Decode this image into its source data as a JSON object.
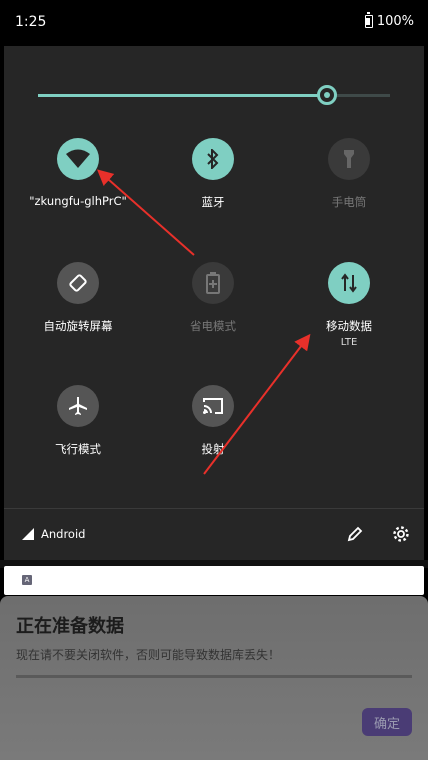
{
  "status_bar": {
    "time": "1:25",
    "battery": "100%"
  },
  "brightness": {
    "level": 0.82
  },
  "tiles": [
    {
      "label": "\"zkungfu-glhPrC\"",
      "icon": "wifi-icon",
      "state": "on"
    },
    {
      "label": "蓝牙",
      "icon": "bluetooth-icon",
      "state": "on"
    },
    {
      "label": "手电筒",
      "icon": "flashlight-icon",
      "state": "dim"
    },
    {
      "label": "自动旋转屏幕",
      "icon": "auto-rotate-icon",
      "state": "off"
    },
    {
      "label": "省电模式",
      "icon": "battery-saver-icon",
      "state": "dim"
    },
    {
      "label": "移动数据",
      "sub": "LTE",
      "icon": "mobile-data-icon",
      "state": "on"
    },
    {
      "label": "飞行模式",
      "icon": "airplane-icon",
      "state": "off"
    },
    {
      "label": "投射",
      "icon": "cast-icon",
      "state": "off"
    }
  ],
  "footer": {
    "carrier": "Android"
  },
  "dialog": {
    "title": "正在准备数据",
    "message": "现在请不要关闭软件，否则可能导致数据库丢失！",
    "ok_label": "确定"
  },
  "colors": {
    "accent": "#7fcfc2",
    "panel": "#262626",
    "arrow": "#e8302a",
    "dialog_button": "#4a3c75"
  }
}
